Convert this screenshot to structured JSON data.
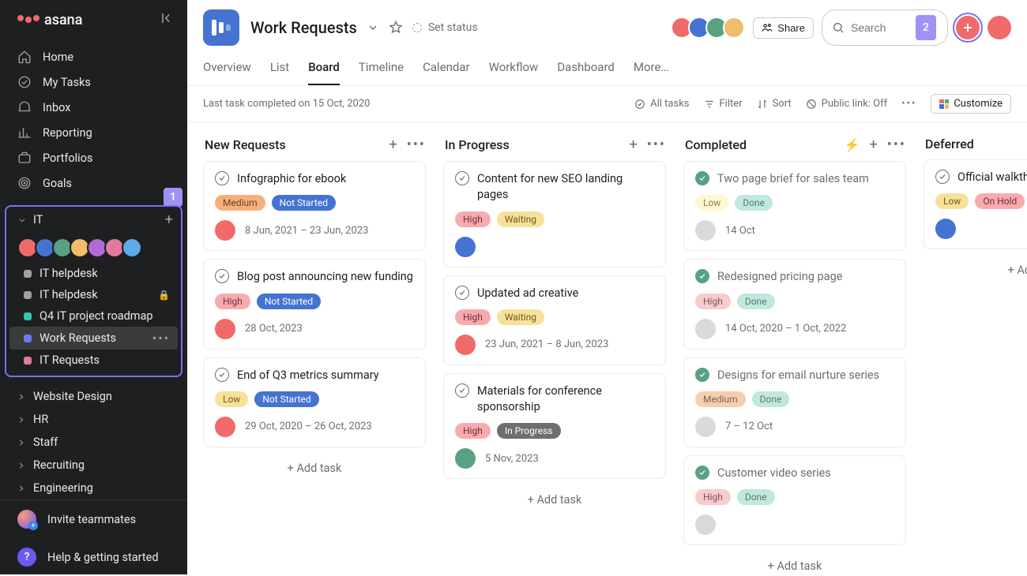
{
  "brand": "asana",
  "sidebar": {
    "nav": [
      {
        "label": "Home"
      },
      {
        "label": "My Tasks"
      },
      {
        "label": "Inbox"
      },
      {
        "label": "Reporting"
      },
      {
        "label": "Portfolios"
      },
      {
        "label": "Goals"
      }
    ],
    "highlight1_badge": "1",
    "highlight2_badge": "2",
    "team_section": {
      "label": "IT"
    },
    "team_avatars": [
      "avc-1",
      "avc-2",
      "avc-3",
      "avc-4",
      "avc-5",
      "avc-6",
      "avc-7"
    ],
    "projects": [
      {
        "label": "IT helpdesk",
        "dot": "#a2a0a2",
        "lock": false
      },
      {
        "label": "IT helpdesk",
        "dot": "#a2a0a2",
        "lock": true
      },
      {
        "label": "Q4 IT project roadmap",
        "dot": "#37c5ab",
        "lock": false
      },
      {
        "label": "Work Requests",
        "dot": "#6a7bf0",
        "lock": false,
        "active": true
      },
      {
        "label": "IT Requests",
        "dot": "#e07ba0",
        "lock": false
      }
    ],
    "teams": [
      {
        "label": "Website Design"
      },
      {
        "label": "HR"
      },
      {
        "label": "Staff"
      },
      {
        "label": "Recruiting"
      },
      {
        "label": "Engineering"
      }
    ],
    "invite": "Invite teammates",
    "help": "Help & getting started"
  },
  "header": {
    "title": "Work Requests",
    "status": "Set status",
    "share": "Share",
    "search_placeholder": "Search",
    "tabs": [
      "Overview",
      "List",
      "Board",
      "Timeline",
      "Calendar",
      "Workflow",
      "Dashboard",
      "More…"
    ],
    "active_tab": "Board",
    "faces": [
      "avc-1",
      "avc-2",
      "avc-3",
      "avc-4"
    ]
  },
  "toolbar": {
    "status": "Last task completed on 15 Oct, 2020",
    "all_tasks": "All tasks",
    "filter": "Filter",
    "sort": "Sort",
    "public_link": "Public link: Off",
    "customize": "Customize"
  },
  "board": {
    "columns": [
      {
        "name": "New Requests",
        "actions": [
          "plus",
          "kebab"
        ],
        "cards": [
          {
            "title": "Infographic for ebook",
            "tags": [
              {
                "t": "Medium",
                "c": "c-medium"
              },
              {
                "t": "Not Started",
                "c": "c-notstarted"
              }
            ],
            "av": "avc-1",
            "date": "8 Jun, 2021 – 23 Jun, 2023"
          },
          {
            "title": "Blog post announcing new funding",
            "tags": [
              {
                "t": "High",
                "c": "c-high"
              },
              {
                "t": "Not Started",
                "c": "c-notstarted"
              }
            ],
            "av": "avc-1",
            "date": "28 Oct, 2023"
          },
          {
            "title": "End of Q3 metrics summary",
            "tags": [
              {
                "t": "Low",
                "c": "c-low"
              },
              {
                "t": "Not Started",
                "c": "c-notstarted"
              }
            ],
            "av": "avc-1",
            "date": "29 Oct, 2020 – 26 Oct, 2023"
          }
        ],
        "add": "Add task"
      },
      {
        "name": "In Progress",
        "actions": [
          "plus",
          "kebab"
        ],
        "cards": [
          {
            "title": "Content for new SEO landing pages",
            "tags": [
              {
                "t": "High",
                "c": "c-high"
              },
              {
                "t": "Waiting",
                "c": "c-waiting"
              }
            ],
            "av": "avc-2",
            "date": ""
          },
          {
            "title": "Updated ad creative",
            "tags": [
              {
                "t": "High",
                "c": "c-high"
              },
              {
                "t": "Waiting",
                "c": "c-waiting"
              }
            ],
            "av": "avc-1",
            "date": "23 Jun, 2021 – 8 Jun, 2023"
          },
          {
            "title": "Materials for conference sponsorship",
            "tags": [
              {
                "t": "High",
                "c": "c-high"
              },
              {
                "t": "In Progress",
                "c": "c-inprogress"
              }
            ],
            "av": "avc-3",
            "date": "5 Nov, 2023"
          }
        ],
        "add": "Add task"
      },
      {
        "name": "Completed",
        "faded": true,
        "actions": [
          "bolt",
          "plus",
          "kebab"
        ],
        "cards": [
          {
            "title": "Two page brief for sales team",
            "done": true,
            "tags": [
              {
                "t": "Low",
                "c": "c-low"
              },
              {
                "t": "Done",
                "c": "c-done"
              }
            ],
            "av": "placeholder",
            "date": "14 Oct"
          },
          {
            "title": "Redesigned pricing page",
            "done": true,
            "tags": [
              {
                "t": "High",
                "c": "c-high"
              },
              {
                "t": "Done",
                "c": "c-done"
              }
            ],
            "av": "placeholder",
            "date": "14 Oct, 2020 – 1 Oct, 2022"
          },
          {
            "title": "Designs for email nurture series",
            "done": true,
            "tags": [
              {
                "t": "Medium",
                "c": "c-medium"
              },
              {
                "t": "Done",
                "c": "c-done"
              }
            ],
            "av": "placeholder",
            "date": "7 – 12 Oct"
          },
          {
            "title": "Customer video series",
            "done": true,
            "tags": [
              {
                "t": "High",
                "c": "c-high"
              },
              {
                "t": "Done",
                "c": "c-done"
              }
            ],
            "av": "placeholder",
            "date": ""
          }
        ],
        "add": "Add task"
      },
      {
        "name": "Deferred",
        "actions": [],
        "cards": [
          {
            "title": "Official walkthrough candidates",
            "tags": [
              {
                "t": "Low",
                "c": "c-low"
              },
              {
                "t": "On Hold",
                "c": "c-onhold"
              }
            ],
            "av": "avc-2",
            "date": ""
          }
        ],
        "add": "Add task",
        "addRight": "+ Add"
      }
    ]
  }
}
